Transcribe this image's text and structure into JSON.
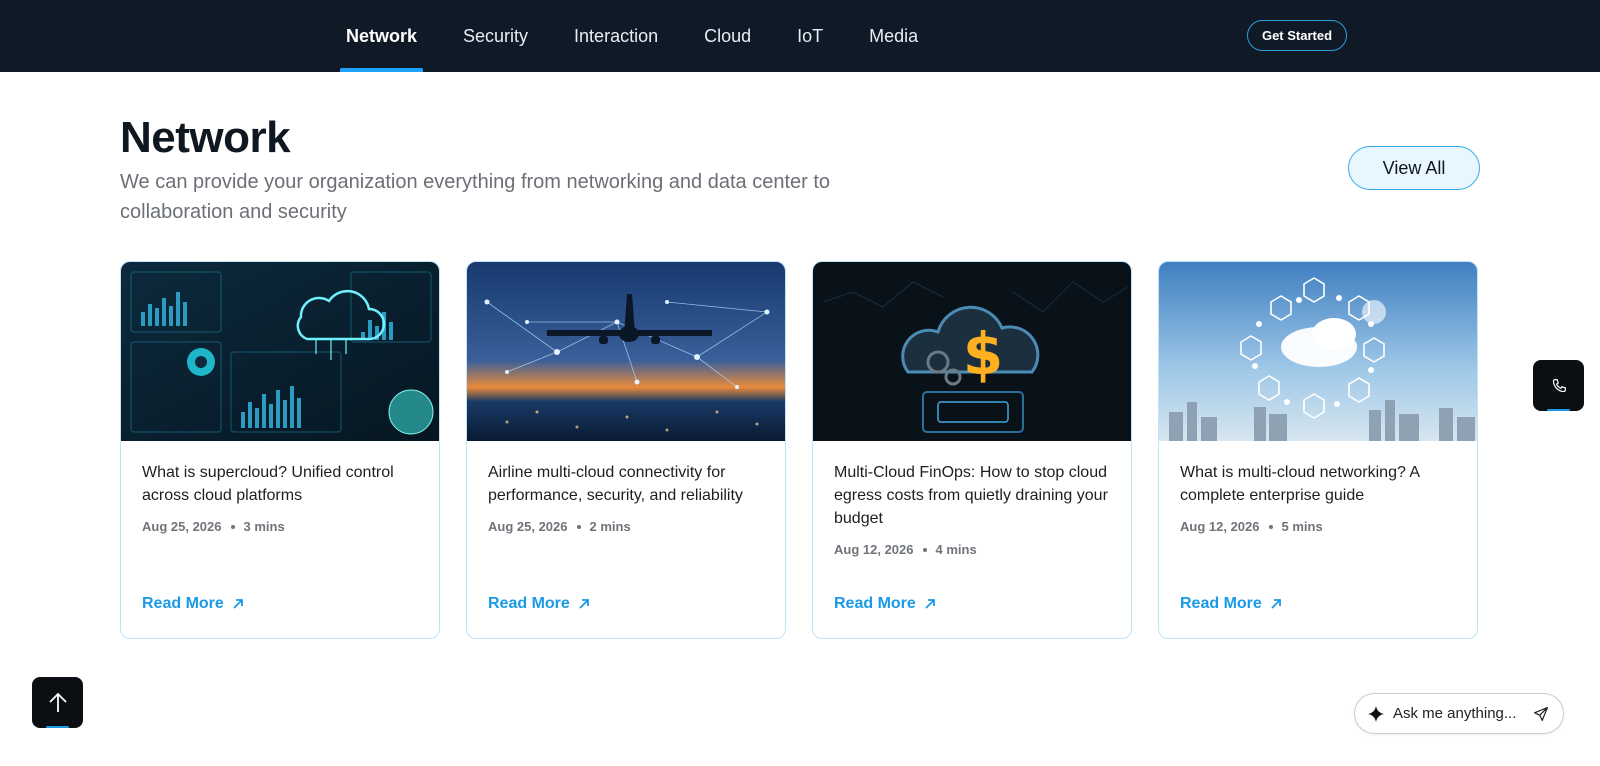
{
  "nav": {
    "tabs": [
      {
        "label": "Network",
        "active": true
      },
      {
        "label": "Security",
        "active": false
      },
      {
        "label": "Interaction",
        "active": false
      },
      {
        "label": "Cloud",
        "active": false
      },
      {
        "label": "IoT",
        "active": false
      },
      {
        "label": "Media",
        "active": false
      }
    ],
    "cta_label": "Get Started"
  },
  "section": {
    "title": "Network",
    "description": "We can provide your organization everything from networking and data center to collaboration and security",
    "view_all_label": "View All"
  },
  "cards": [
    {
      "title": "What is supercloud? Unified control across cloud platforms",
      "date": "Aug 25, 2026",
      "read_time": "3 mins",
      "link_label": "Read More",
      "image": "cloud-dashboard-image"
    },
    {
      "title": "Airline multi-cloud connectivity for performance, security, and reliability",
      "date": "Aug 25, 2026",
      "read_time": "2 mins",
      "link_label": "Read More",
      "image": "airplane-network-image"
    },
    {
      "title": "Multi-Cloud FinOps: How to stop cloud egress costs from quietly draining your budget",
      "date": "Aug 12, 2026",
      "read_time": "4 mins",
      "link_label": "Read More",
      "image": "cloud-dollar-image"
    },
    {
      "title": "What is multi-cloud networking? A complete enterprise guide",
      "date": "Aug 12, 2026",
      "read_time": "5 mins",
      "link_label": "Read More",
      "image": "cloud-city-icons-image"
    }
  ],
  "assistant": {
    "placeholder": "Ask me anything..."
  },
  "colors": {
    "nav_bg": "#101a26",
    "accent": "#1a9ae6",
    "card_border": "#bfe3f7"
  }
}
